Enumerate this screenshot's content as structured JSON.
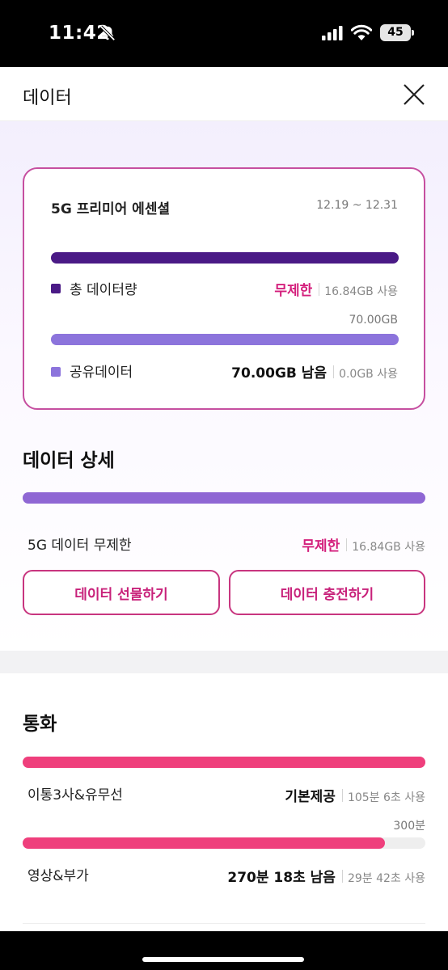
{
  "status_bar": {
    "time": "11:42",
    "battery": "45",
    "icons": [
      "bell-slash-icon",
      "cellular-signal-icon",
      "wifi-icon",
      "battery-icon"
    ]
  },
  "header": {
    "title": "데이터",
    "close_icon": "close-icon"
  },
  "plan_card": {
    "name": "5G 프리미어 에센셜",
    "period": "12.19 ~ 12.31",
    "total": {
      "label": "총 데이터량",
      "value": "무제한",
      "used": "16.84GB 사용",
      "fill_fraction": 1.0,
      "color": "#4a1a86"
    },
    "shared": {
      "cap": "70.00GB",
      "label": "공유데이터",
      "value": "70.00GB 남음",
      "used": "0.0GB 사용",
      "fill_fraction": 1.0,
      "color": "#8c74dc"
    }
  },
  "data_detail": {
    "title": "데이터 상세",
    "item": {
      "label": "5G 데이터 무제한",
      "value": "무제한",
      "used": "16.84GB 사용",
      "fill_fraction": 1.0,
      "color": "#8f67d4"
    },
    "gift_button": "데이터 선물하기",
    "charge_button": "데이터 충전하기"
  },
  "call": {
    "title": "통화",
    "basic": {
      "label": "이통3사&유무선",
      "value": "기본제공",
      "used": "105분 6초 사용",
      "fill_fraction": 1.0,
      "color": "#ef3f7c"
    },
    "video": {
      "cap": "300분",
      "label": "영상&부가",
      "value": "270분 18초 남음",
      "used": "29분 42초 사용",
      "fill_fraction": 0.9,
      "color": "#ef3f7c"
    }
  },
  "colors": {
    "accent_pink": "#d41f7c",
    "card_border": "#c64fa0",
    "track_gray": "#eeeeee"
  }
}
